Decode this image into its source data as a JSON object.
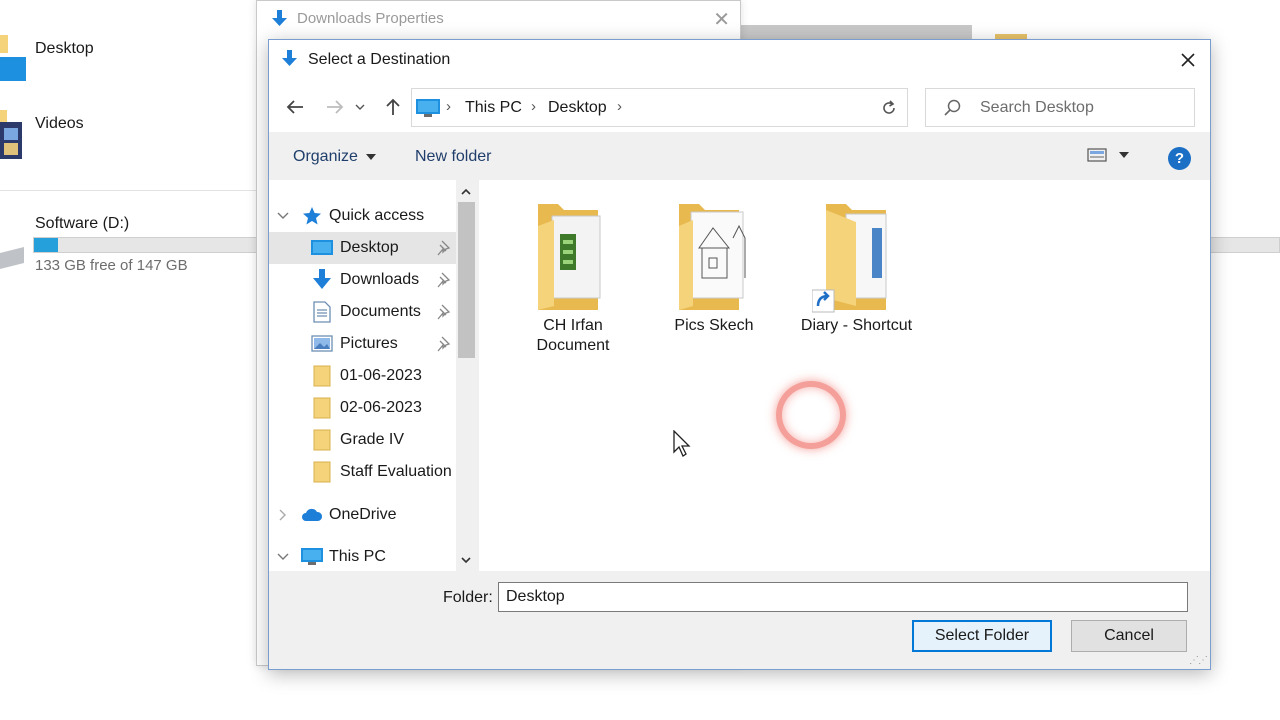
{
  "background": {
    "items": [
      {
        "label": "Desktop"
      },
      {
        "label": "Videos"
      }
    ],
    "drive": {
      "label": "Software (D:)",
      "free_text": "133 GB free of 147 GB",
      "used_fraction": 0.1
    }
  },
  "properties_window": {
    "title": "Downloads Properties"
  },
  "dialog": {
    "title": "Select a Destination",
    "address": {
      "segments": [
        "This PC",
        "Desktop"
      ]
    },
    "search_placeholder": "Search Desktop",
    "toolbar": {
      "organize": "Organize",
      "new_folder": "New folder"
    },
    "nav_pane": {
      "items": [
        {
          "label": "Quick access",
          "icon": "star-icon"
        },
        {
          "label": "Desktop",
          "icon": "desktop-icon",
          "pinned": true,
          "selected": true
        },
        {
          "label": "Downloads",
          "icon": "download-icon",
          "pinned": true
        },
        {
          "label": "Documents",
          "icon": "documents-icon",
          "pinned": true
        },
        {
          "label": "Pictures",
          "icon": "pictures-icon",
          "pinned": true
        },
        {
          "label": "01-06-2023",
          "icon": "folder-icon"
        },
        {
          "label": "02-06-2023",
          "icon": "folder-icon"
        },
        {
          "label": "Grade IV",
          "icon": "folder-icon"
        },
        {
          "label": "Staff Evaluation",
          "icon": "folder-icon"
        },
        {
          "label": "OneDrive",
          "icon": "cloud-icon"
        },
        {
          "label": "This PC",
          "icon": "computer-icon"
        }
      ]
    },
    "folders": [
      {
        "name": "CH Irfan Document"
      },
      {
        "name": "Pics Skech"
      },
      {
        "name": "Diary - Shortcut",
        "shortcut": true
      }
    ],
    "folder_field": {
      "label": "Folder:",
      "value": "Desktop"
    },
    "buttons": {
      "select_folder": "Select Folder",
      "cancel": "Cancel"
    }
  },
  "colors": {
    "accent": "#0078d7",
    "folder": "#f5d37a",
    "selected": "#e5e5e5"
  }
}
